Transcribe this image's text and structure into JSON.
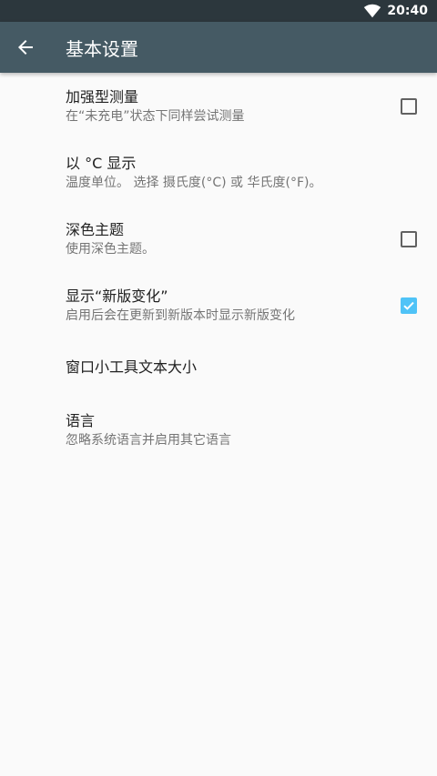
{
  "status_bar": {
    "time": "20:40"
  },
  "app_bar": {
    "title": "基本设置"
  },
  "preferences": [
    {
      "title": "加强型测量",
      "summary": "在“未充电”状态下同样尝试测量",
      "checked": false
    },
    {
      "title": "以 °C 显示",
      "summary": "温度单位。 选择 摄氏度(°C) 或 华氏度(°F)。"
    },
    {
      "title": "深色主题",
      "summary": "使用深色主题。",
      "checked": false
    },
    {
      "title": "显示“新版变化”",
      "summary": "启用后会在更新到新版本时显示新版变化",
      "checked": true
    },
    {
      "title": "窗口小工具文本大小"
    },
    {
      "title": "语言",
      "summary": "忽略系统语言并启用其它语言"
    }
  ],
  "colors": {
    "status_bar": "#2c373d",
    "app_bar": "#455a64",
    "accent": "#4fc3f7"
  }
}
